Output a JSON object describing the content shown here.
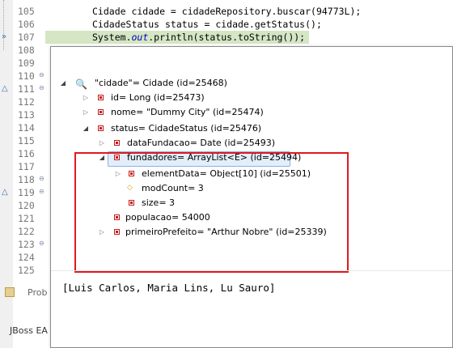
{
  "editor": {
    "lines": [
      {
        "num": "105",
        "code": "Cidade cidade = cidadeRepository.buscar(94773L);",
        "fold": false,
        "highlight": false
      },
      {
        "num": "106",
        "code": "CidadeStatus status = cidade.getStatus();",
        "fold": false,
        "highlight": false
      },
      {
        "num": "107",
        "code_prefix": "System.",
        "code_ital": "out",
        "code_suffix": ".println(status.toString());",
        "fold": false,
        "highlight": true,
        "marker": "debug-pointer"
      },
      {
        "num": "108",
        "code": "",
        "fold": false,
        "highlight": false
      },
      {
        "num": "109",
        "code": "",
        "fold": false,
        "highlight": false
      },
      {
        "num": "110",
        "code": "",
        "fold": true,
        "highlight": false
      },
      {
        "num": "111",
        "code": "",
        "fold": true,
        "highlight": false,
        "marker": "override"
      },
      {
        "num": "112",
        "code": "",
        "fold": false,
        "highlight": false
      },
      {
        "num": "113",
        "code": "",
        "fold": false,
        "highlight": false
      },
      {
        "num": "114",
        "code": "",
        "fold": false,
        "highlight": false
      },
      {
        "num": "115",
        "code": "",
        "fold": false,
        "highlight": false
      },
      {
        "num": "116",
        "code": "",
        "fold": false,
        "highlight": false
      },
      {
        "num": "117",
        "code": "",
        "fold": false,
        "highlight": false
      },
      {
        "num": "118",
        "code": "",
        "fold": true,
        "highlight": false
      },
      {
        "num": "119",
        "code": "",
        "fold": true,
        "highlight": false,
        "marker": "override"
      },
      {
        "num": "120",
        "code": "",
        "fold": false,
        "highlight": false
      },
      {
        "num": "121",
        "code": "",
        "fold": false,
        "highlight": false
      },
      {
        "num": "122",
        "code": "",
        "fold": false,
        "highlight": false
      },
      {
        "num": "123",
        "code": "",
        "fold": true,
        "highlight": false
      },
      {
        "num": "124",
        "code": "",
        "fold": false,
        "highlight": false
      },
      {
        "num": "125",
        "code": "",
        "fold": false,
        "highlight": false
      }
    ],
    "problems_tab": "Prob",
    "status_left": "JBoss EA"
  },
  "inspect": {
    "root": {
      "label": "\"cidade\"= Cidade  (id=25468)"
    },
    "rows": [
      {
        "label": "id= Long  (id=25473)"
      },
      {
        "label": "nome= \"Dummy City\" (id=25474)"
      },
      {
        "label": "status= CidadeStatus  (id=25476)"
      },
      {
        "label": "dataFundacao= Date  (id=25493)"
      },
      {
        "label": "fundadores= ArrayList<E>  (id=25494)"
      },
      {
        "label": "elementData= Object[10]  (id=25501)"
      },
      {
        "label": "modCount= 3"
      },
      {
        "label": "size= 3"
      },
      {
        "label": "populacao= 54000"
      },
      {
        "label": "primeiroPrefeito= \"Arthur Nobre\" (id=25339)"
      }
    ],
    "detail": "[Luis Carlos, Maria Lins, Lu Sauro]",
    "highlight_color": "#e0191f",
    "selection_color": "#e3eefb"
  }
}
